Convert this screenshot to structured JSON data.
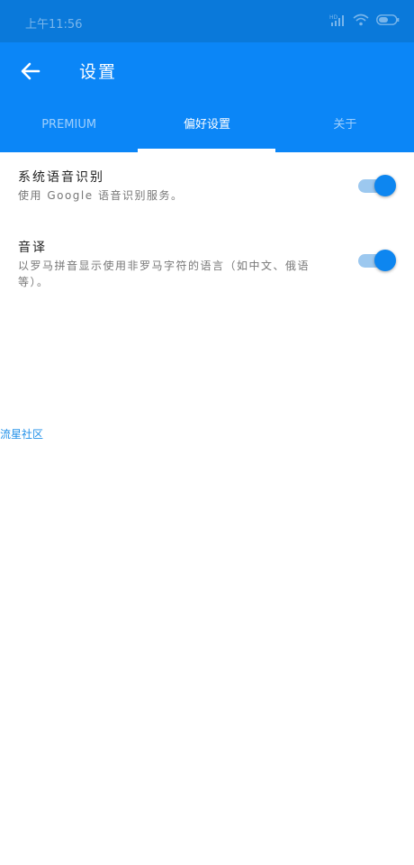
{
  "status_bar": {
    "time": "上午11:56",
    "icons": [
      "hd-signal-icon",
      "wifi-icon",
      "battery-icon"
    ]
  },
  "appbar": {
    "title": "设置",
    "back_icon": "arrow-left-icon"
  },
  "tabs": [
    {
      "label": "PREMIUM",
      "active": false
    },
    {
      "label": "偏好设置",
      "active": true
    },
    {
      "label": "关于",
      "active": false
    }
  ],
  "settings": [
    {
      "title": "系统语音识别",
      "description": "使用 Google 语音识别服务。",
      "enabled": true
    },
    {
      "title": "音译",
      "description": "以罗马拼音显示使用非罗马字符的语言（如中文、俄语等）。",
      "enabled": true
    }
  ],
  "watermark": "流星社区",
  "colors": {
    "status_bar": "#0a79da",
    "appbar": "#0b86f7",
    "toggle_thumb": "#0d86f0",
    "toggle_track": "#9cc8ef",
    "background": "#ffffff"
  }
}
